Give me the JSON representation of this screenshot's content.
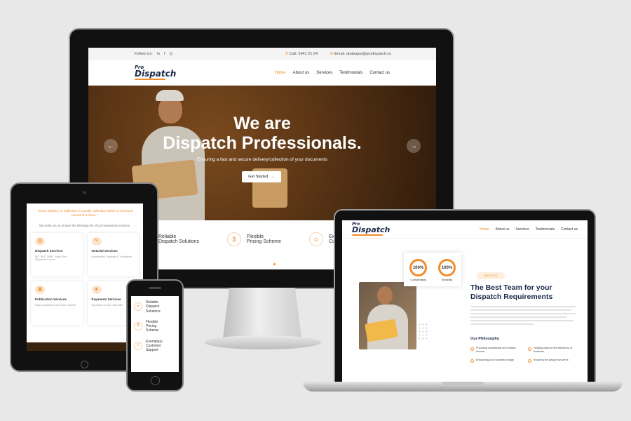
{
  "desktop": {
    "topbar": {
      "follow": "Follow Us:",
      "social": [
        "in",
        "f",
        "◎"
      ],
      "call": "Call: 5941 21 24",
      "email": "Email: ababajee@prodispatch.co"
    },
    "logo": {
      "line1": "Pro",
      "line2": "Dispatch"
    },
    "nav": [
      "Home",
      "About us",
      "Services",
      "Testimonials",
      "Contact us"
    ],
    "hero": {
      "title_line1": "We are",
      "title_line2": "Dispatch Professionals.",
      "subtitle": "Ensuring a fast and secure delivery/collection of your documents",
      "cta": "Get Started"
    },
    "features": [
      {
        "line1": "Reliable",
        "line2": "Dispatch Solutions"
      },
      {
        "line1": "Flexible",
        "line2": "Pricing Scheme"
      },
      {
        "line1": "Ex",
        "line2": "Cu"
      }
    ]
  },
  "tablet": {
    "quote": "\" Every delivery or collection is usually submitted within a maximum period of 5 hours \"",
    "invite": "We invite you to browse the following list of our businesses services.",
    "cards": [
      {
        "title": "Dispatch Services",
        "desc": "IPC, BPC, UMB, Traffic Fine Payments & more"
      },
      {
        "title": "Notarial Services",
        "desc": "Notarisation / Apostille & Translation"
      },
      {
        "title": "Publication Services",
        "desc": "Daily newspapers and Govt. Gazette"
      },
      {
        "title": "Payments Services",
        "desc": "Payments of your utility bills"
      }
    ]
  },
  "phone": {
    "features": [
      {
        "l1": "Reliable",
        "l2": "Dispatch",
        "l3": "Solutions"
      },
      {
        "l1": "Flexible",
        "l2": "Pricing",
        "l3": "Scheme"
      },
      {
        "l1": "Exemplary",
        "l2": "Customer",
        "l3": "Support"
      }
    ]
  },
  "laptop": {
    "logo": {
      "line1": "Pro",
      "line2": "Dispatch"
    },
    "nav": [
      "Home",
      "About us",
      "Services",
      "Testimonials",
      "Contact us"
    ],
    "stats": [
      {
        "value": "100%",
        "label": "Confidentiality"
      },
      {
        "value": "100%",
        "label": "Reliability"
      }
    ],
    "badge": "ABOUT US",
    "heading": "The Best Team for your Dispatch Requirements",
    "philosophy_title": "Our Philosophy",
    "philosophy": [
      "Providing confidential and reliable service.",
      "Helping improve the efficiency of business.",
      "Enhancing your business image.",
      "Knowing the people we serve."
    ]
  },
  "colors": {
    "accent": "#f28c28",
    "navy": "#1b2a4a"
  }
}
